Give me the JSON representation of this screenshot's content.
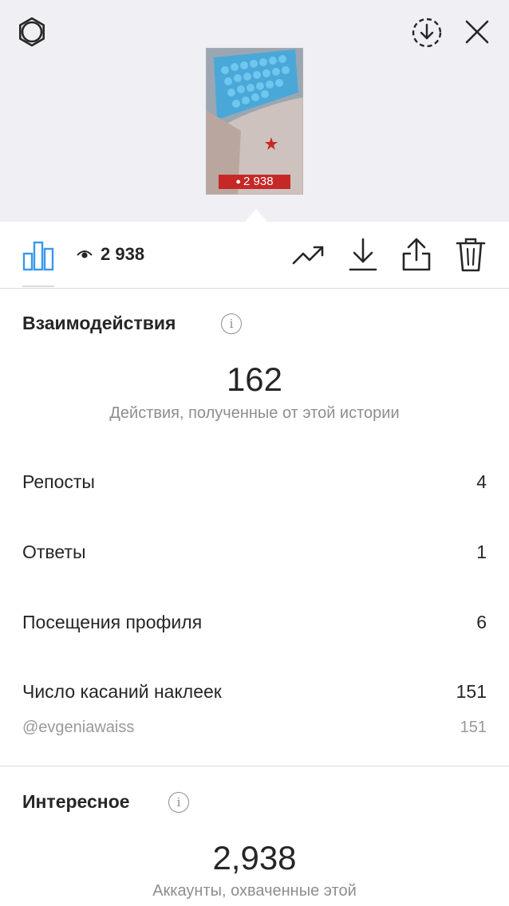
{
  "header": {
    "settings_icon": "settings-icon",
    "save_icon": "download-circle-icon",
    "close_icon": "close-icon"
  },
  "story_preview": {
    "badge_views": "2 938"
  },
  "toolbar": {
    "insights_icon": "bar-chart-icon",
    "views_icon": "eye-icon",
    "views_count": "2 938",
    "actions": [
      "promote-icon",
      "download-icon",
      "share-icon",
      "trash-icon"
    ]
  },
  "interactions": {
    "title": "Взаимодействия",
    "total": "162",
    "caption": "Действия, полученные от этой истории",
    "rows": [
      {
        "label": "Репосты",
        "value": "4"
      },
      {
        "label": "Ответы",
        "value": "1"
      },
      {
        "label": "Посещения профиля",
        "value": "6"
      },
      {
        "label": "Число касаний наклеек",
        "value": "151"
      }
    ],
    "sub_row": {
      "label": "@evgeniawaiss",
      "value": "151"
    }
  },
  "discovery": {
    "title": "Интересное",
    "total": "2,938",
    "caption": "Аккаунты, охваченные этой"
  },
  "colors": {
    "accent": "#3897f0",
    "header_bg": "#efeff4",
    "badge_red": "#c62828"
  }
}
